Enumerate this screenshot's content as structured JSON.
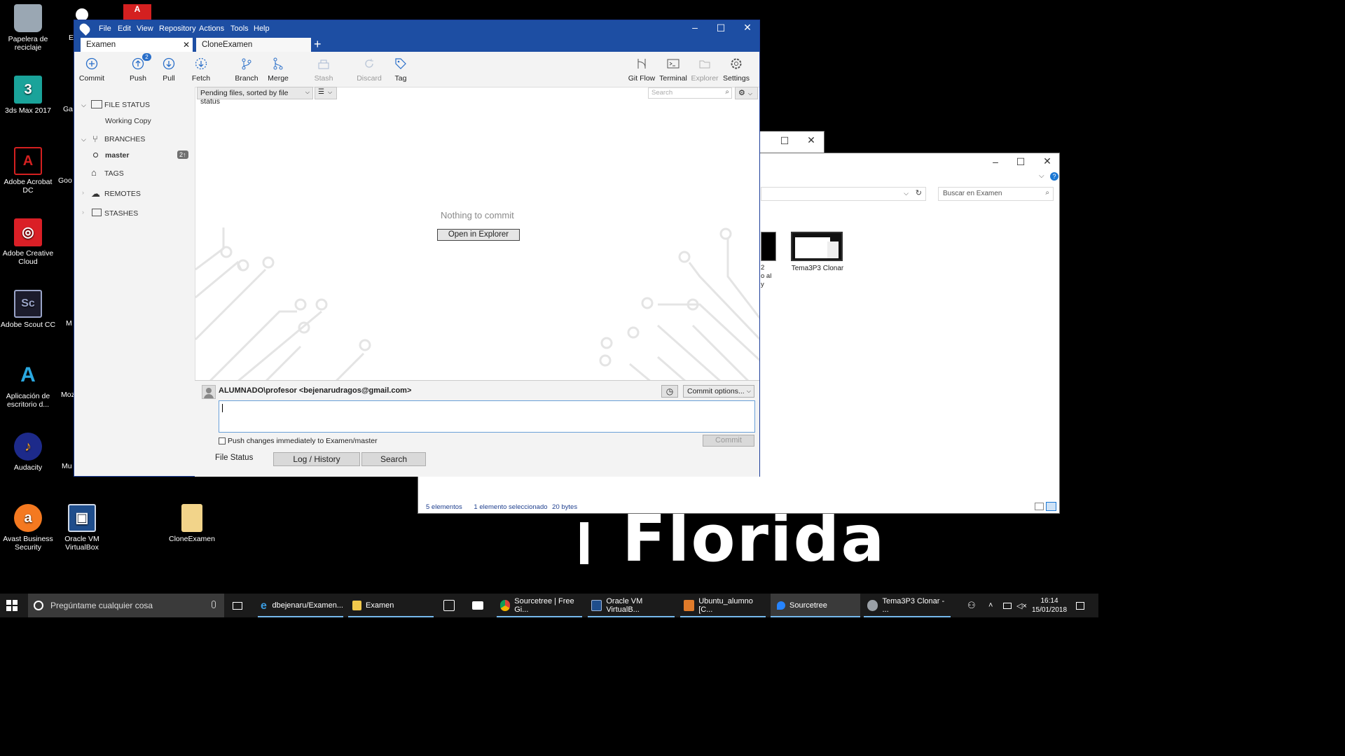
{
  "desktop_icons": [
    {
      "label": "Papelera de reciclaje",
      "icon": "recycle-bin-icon"
    },
    {
      "label": "3ds Max 2017",
      "icon": "3ds-max-icon"
    },
    {
      "label": "Adobe Acrobat DC",
      "icon": "acrobat-icon"
    },
    {
      "label": "Adobe Creative Cloud",
      "icon": "creative-cloud-icon"
    },
    {
      "label": "Adobe Scout CC",
      "icon": "scout-icon"
    },
    {
      "label": "Aplicación de escritorio d...",
      "icon": "azure-icon"
    },
    {
      "label": "Audacity",
      "icon": "audacity-icon"
    },
    {
      "label": "Avast Business Security",
      "icon": "avast-icon"
    },
    {
      "label": "Oracle VM VirtualBox",
      "icon": "virtualbox-icon"
    },
    {
      "label": "CloneExamen",
      "icon": "folder-icon"
    }
  ],
  "desktop_partial_labels": [
    "E",
    "Ga",
    "Goo",
    "M",
    "Moz",
    "Mu"
  ],
  "florida_logo": "Florida",
  "explorer": {
    "search_placeholder": "Buscar en Examen",
    "file_label": "Tema3P3 Clonar",
    "partial_file_text": [
      "2",
      "o al",
      "y"
    ],
    "status_items": "5 elementos",
    "status_selected": "1 elemento seleccionado",
    "status_size": "20 bytes"
  },
  "sourcetree": {
    "menu": [
      "File",
      "Edit",
      "View",
      "Repository",
      "Actions",
      "Tools",
      "Help"
    ],
    "tabs": [
      "Examen",
      "CloneExamen"
    ],
    "toolbar_left": [
      {
        "label": "Commit",
        "icon": "commit-icon"
      },
      {
        "label": "Push",
        "icon": "push-icon",
        "badge": "2"
      },
      {
        "label": "Pull",
        "icon": "pull-icon"
      },
      {
        "label": "Fetch",
        "icon": "fetch-icon"
      },
      {
        "label": "Branch",
        "icon": "branch-icon"
      },
      {
        "label": "Merge",
        "icon": "merge-icon"
      },
      {
        "label": "Stash",
        "icon": "stash-icon",
        "disabled": true
      },
      {
        "label": "Discard",
        "icon": "discard-icon",
        "disabled": true
      },
      {
        "label": "Tag",
        "icon": "tag-icon"
      }
    ],
    "toolbar_right": [
      {
        "label": "Git Flow",
        "icon": "git-flow-icon"
      },
      {
        "label": "Terminal",
        "icon": "terminal-icon"
      },
      {
        "label": "Explorer",
        "icon": "explorer-icon",
        "disabled": true
      },
      {
        "label": "Settings",
        "icon": "settings-icon"
      }
    ],
    "sidebar": {
      "file_status": "FILE STATUS",
      "working_copy": "Working Copy",
      "branches": "BRANCHES",
      "branch_master": "master",
      "branch_badge": "2↑",
      "tags": "TAGS",
      "remotes": "REMOTES",
      "stashes": "STASHES"
    },
    "filter_select": "Pending files, sorted by file status",
    "search_placeholder": "Search",
    "empty_message": "Nothing to commit",
    "open_explorer": "Open in Explorer",
    "author": "ALUMNADO\\profesor <bejenarudragos@gmail.com>",
    "commit_options": "Commit options...",
    "push_checkbox": "Push changes immediately to Examen/master",
    "commit_button": "Commit",
    "bottom_tabs": [
      "File Status",
      "Log / History",
      "Search"
    ]
  },
  "taskbar": {
    "search_placeholder": "Pregúntame cualquier cosa",
    "items": [
      "dbejenaru/Examen...",
      "Examen",
      "Sourcetree | Free Gi...",
      "Oracle VM VirtualB...",
      "Ubuntu_alumno [C...",
      "Sourcetree",
      "Tema3P3 Clonar - ..."
    ],
    "time": "16:14",
    "date": "15/01/2018"
  }
}
